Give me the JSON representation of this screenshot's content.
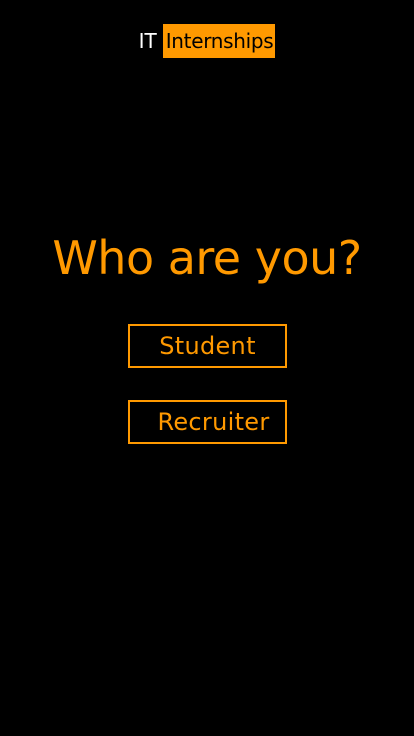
{
  "logo": {
    "prefix": "IT",
    "highlight": "Internships"
  },
  "main": {
    "heading": "Who are you?",
    "buttons": [
      {
        "label": "Student"
      },
      {
        "label": "Recruiter"
      }
    ]
  },
  "colors": {
    "accent": "#ff9900",
    "background": "#000000",
    "logo_text": "#ffffff"
  }
}
